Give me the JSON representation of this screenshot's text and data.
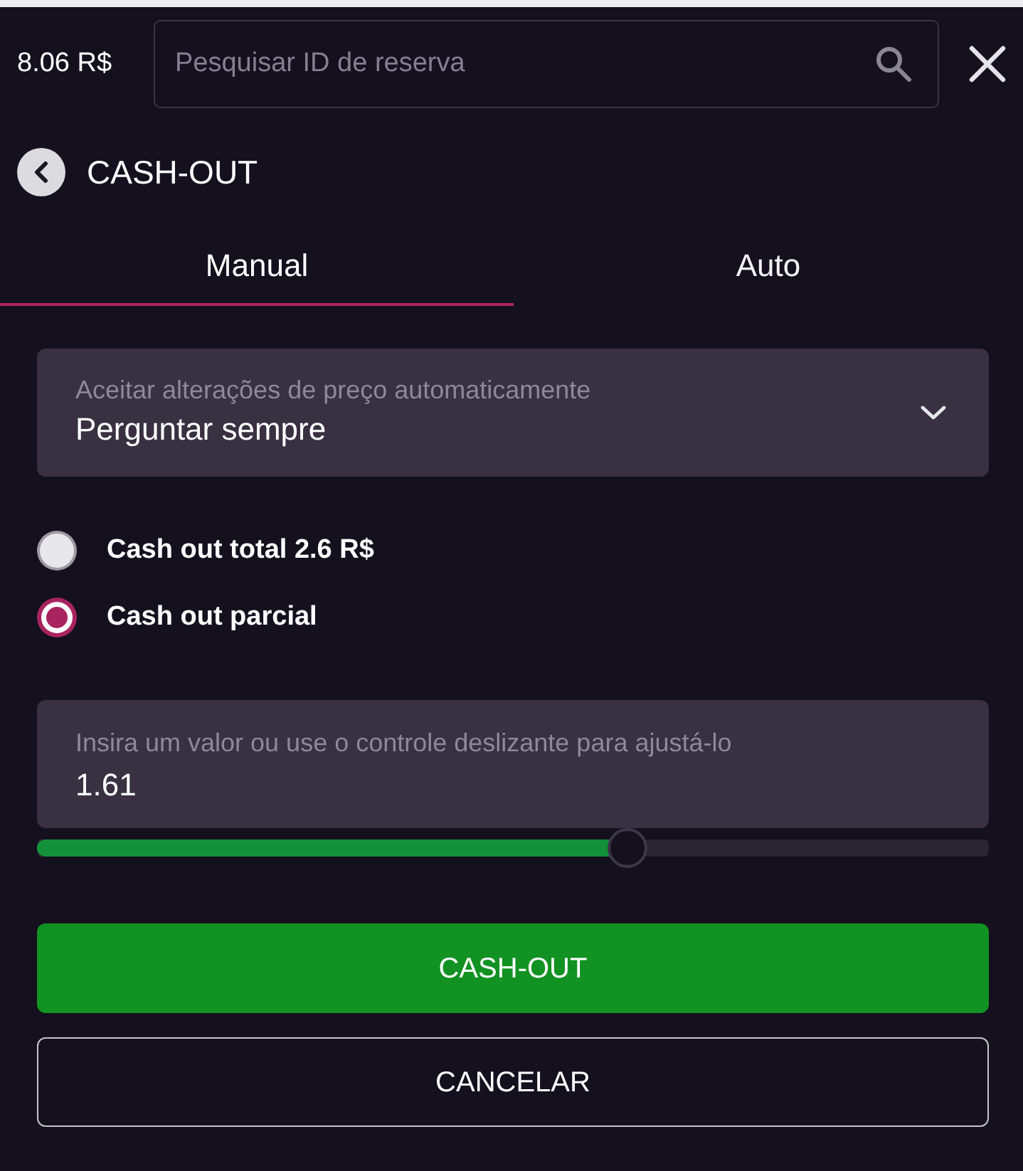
{
  "header": {
    "balance": "8.06 R$",
    "search": {
      "placeholder": "Pesquisar ID de reserva"
    }
  },
  "title": "CASH-OUT",
  "tabs": [
    {
      "label": "Manual",
      "selected": true
    },
    {
      "label": "Auto",
      "selected": false
    }
  ],
  "price_changes": {
    "label": "Aceitar alterações de preço automaticamente",
    "value": "Perguntar sempre"
  },
  "options": [
    {
      "label": "Cash out total 2.6 R$",
      "selected": false
    },
    {
      "label": "Cash out parcial",
      "selected": true
    }
  ],
  "amount": {
    "label": "Insira um valor ou use o controle deslizante para ajustá-lo",
    "value": "1.61",
    "level": 0.62
  },
  "buttons": [
    {
      "label": "CASH-OUT",
      "kind": "primary"
    },
    {
      "label": "CANCELAR",
      "kind": "outline"
    }
  ]
}
